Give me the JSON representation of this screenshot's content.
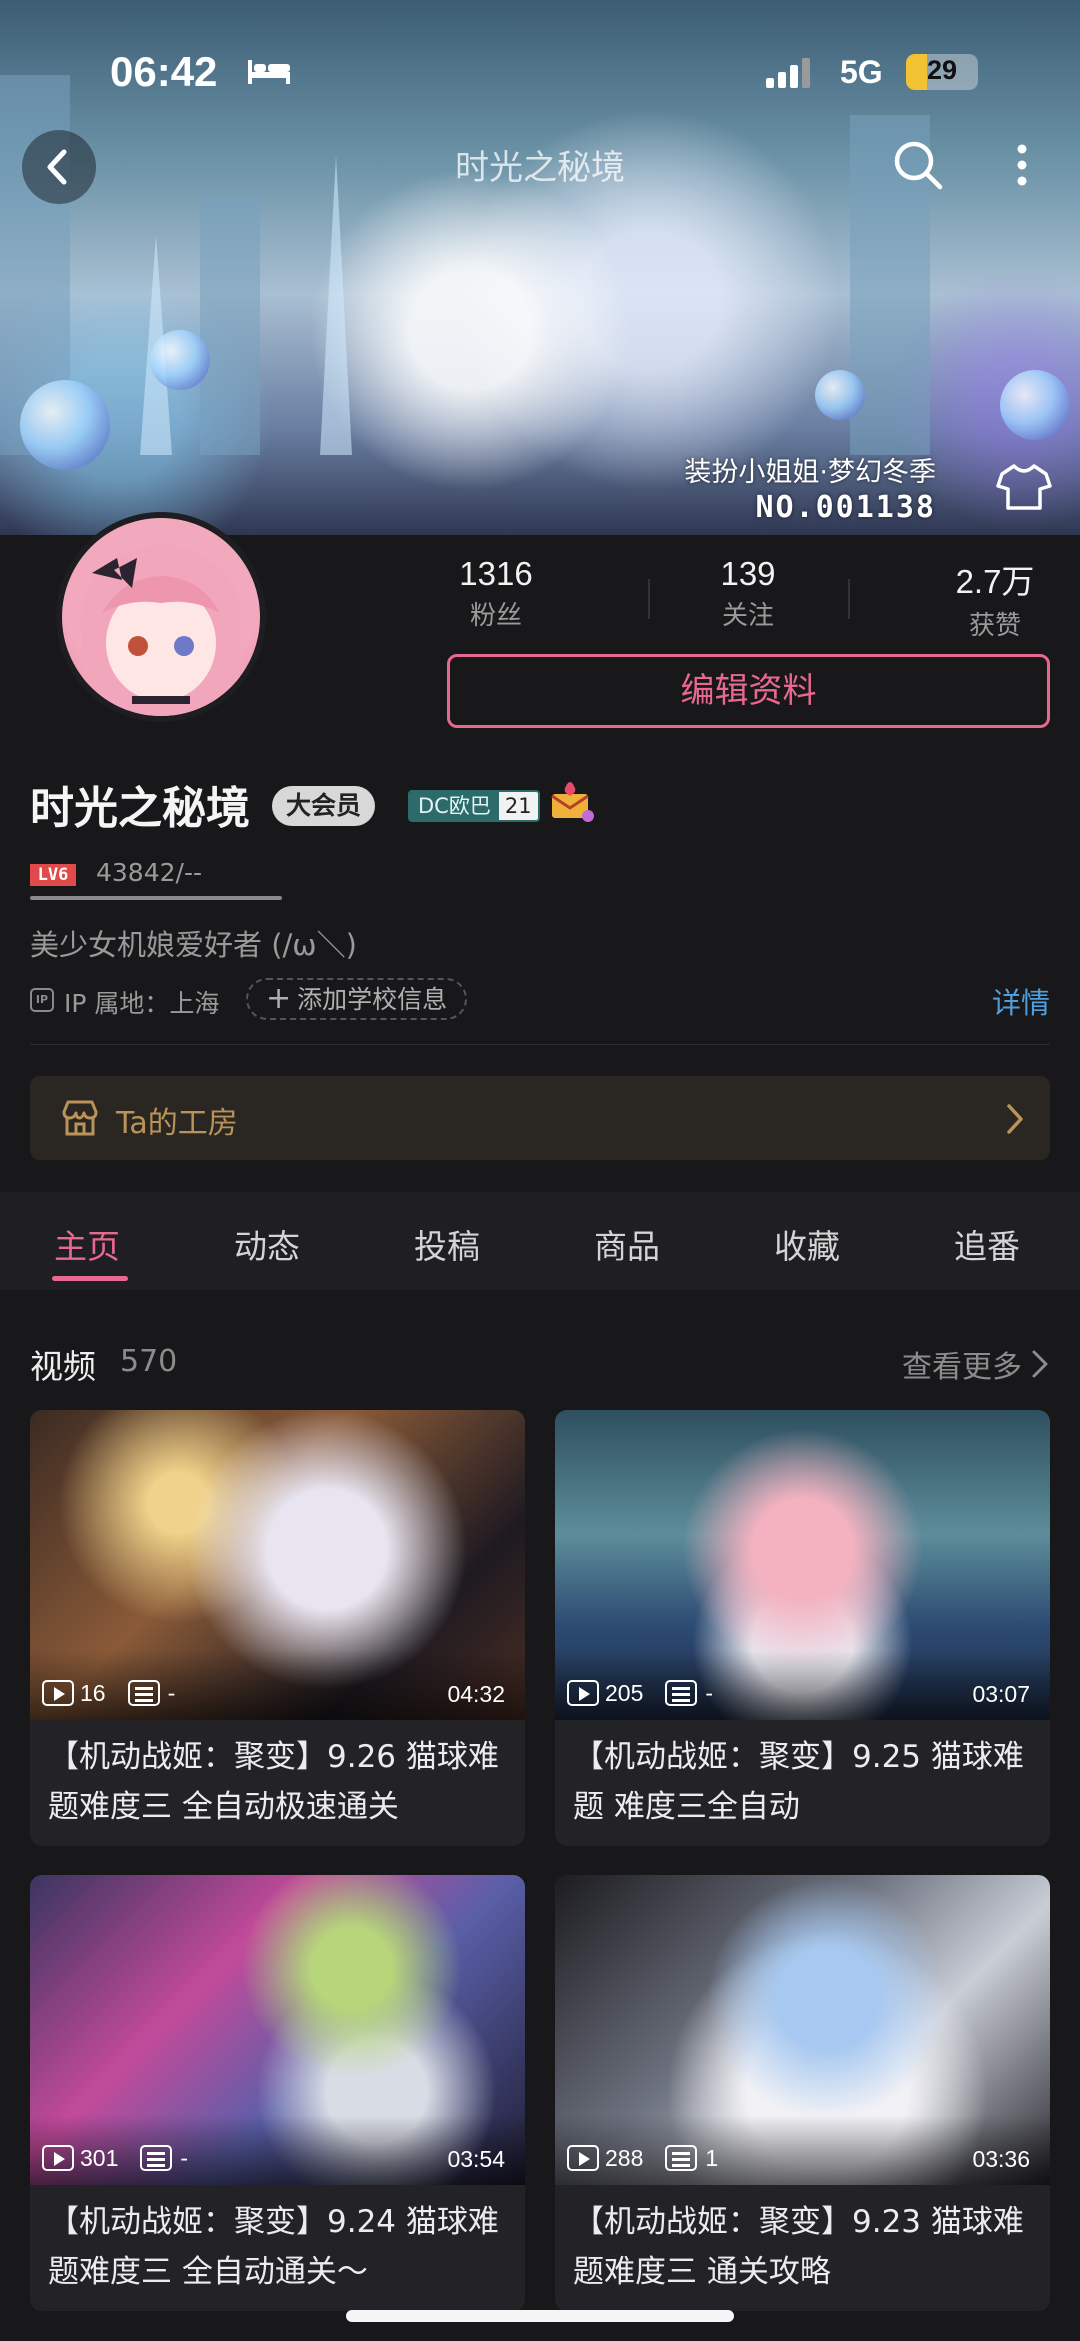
{
  "status_bar": {
    "time": "06:42",
    "network": "5G",
    "battery": "29",
    "battery_fraction": 0.29
  },
  "nav": {
    "title": "时光之秘境"
  },
  "banner": {
    "dress_name": "装扮小姐姐·梦幻冬季",
    "dress_no": "NO.001138"
  },
  "stats": [
    {
      "value": "1316",
      "label": "粉丝"
    },
    {
      "value": "139",
      "label": "关注"
    },
    {
      "value": "2.7万",
      "label": "获赞"
    }
  ],
  "edit_button": "编辑资料",
  "profile": {
    "username": "时光之秘境",
    "vip_badge": "大会员",
    "medal_name": "DC欧巴",
    "medal_level": "21",
    "level_badge": "LV6",
    "exp": "43842/--",
    "exp_fraction": 1.0,
    "signature": "美少女机娘爱好者 (/ω＼)",
    "ip_icon": "IP",
    "ip_location": "IP 属地：上海",
    "add_school": "添加学校信息",
    "detail_link": "详情"
  },
  "workshop": {
    "label": "Ta的工房"
  },
  "tabs": [
    {
      "label": "主页",
      "active": true
    },
    {
      "label": "动态",
      "active": false
    },
    {
      "label": "投稿",
      "active": false
    },
    {
      "label": "商品",
      "active": false
    },
    {
      "label": "收藏",
      "active": false
    },
    {
      "label": "追番",
      "active": false
    }
  ],
  "videos_section": {
    "title": "视频",
    "count": "570",
    "see_more": "查看更多"
  },
  "videos": [
    {
      "plays": "16",
      "danmaku": "-",
      "duration": "04:32",
      "title": "【机动战姬：聚变】9.26 猫球难题难度三 全自动极速通关"
    },
    {
      "plays": "205",
      "danmaku": "-",
      "duration": "03:07",
      "title": "【机动战姬：聚变】9.25 猫球难题 难度三全自动"
    },
    {
      "plays": "301",
      "danmaku": "-",
      "duration": "03:54",
      "title": "【机动战姬：聚变】9.24 猫球难题难度三 全自动通关～"
    },
    {
      "plays": "288",
      "danmaku": "1",
      "duration": "03:36",
      "title": "【机动战姬：聚变】9.23 猫球难题难度三 通关攻略"
    }
  ],
  "colors": {
    "accent": "#e8698f",
    "link": "#4f9fde",
    "workshop_text": "#b9935a",
    "background": "#18181b"
  }
}
